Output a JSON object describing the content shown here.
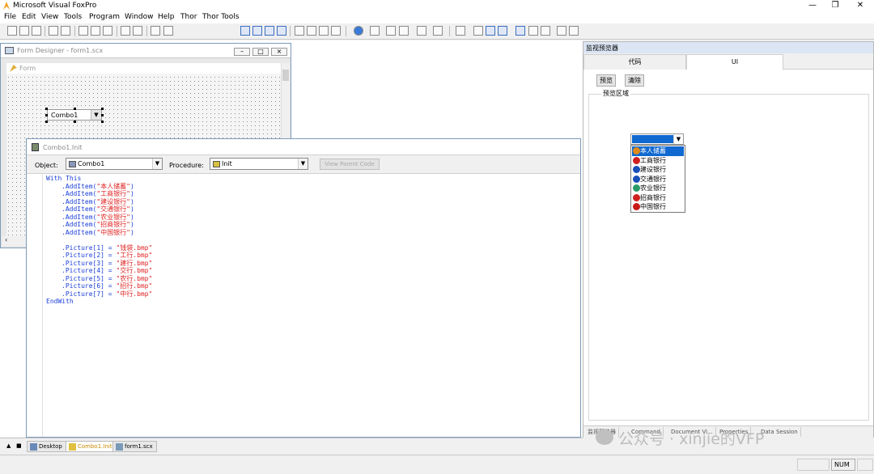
{
  "app": {
    "title": "Microsoft Visual FoxPro"
  },
  "menu": [
    "File",
    "Edit",
    "View",
    "Tools",
    "Program",
    "Window",
    "Help",
    "Thor",
    "Thor Tools"
  ],
  "form_designer": {
    "title": "Form Designer - form1.scx",
    "form_caption": "Form",
    "combo_label": "Combo1"
  },
  "code_window": {
    "title": "Combo1.Init",
    "object_label": "Object:",
    "object_value": "Combo1",
    "procedure_label": "Procedure:",
    "procedure_value": "Init",
    "view_parent_label": "View Parent Code",
    "lines": [
      {
        "text": "With This",
        "kind": "kw",
        "indent": 0
      },
      {
        "fn": ".AddItem(",
        "str": "\"本人储蓄\"",
        "end": ")",
        "indent": 1
      },
      {
        "fn": ".AddItem(",
        "str": "\"工商银行\"",
        "end": ")",
        "indent": 1
      },
      {
        "fn": ".AddItem(",
        "str": "\"建设银行\"",
        "end": ")",
        "indent": 1
      },
      {
        "fn": ".AddItem(",
        "str": "\"交通银行\"",
        "end": ")",
        "indent": 1
      },
      {
        "fn": ".AddItem(",
        "str": "\"农业银行\"",
        "end": ")",
        "indent": 1
      },
      {
        "fn": ".AddItem(",
        "str": "\"招商银行\"",
        "end": ")",
        "indent": 1
      },
      {
        "fn": ".AddItem(",
        "str": "\"中国银行\"",
        "end": ")",
        "indent": 1
      },
      {
        "text": "",
        "kind": "blank",
        "indent": 0
      },
      {
        "fn": ".Picture[1] = ",
        "str": "\"钱袋.bmp\"",
        "end": "",
        "indent": 1
      },
      {
        "fn": ".Picture[2] = ",
        "str": "\"工行.bmp\"",
        "end": "",
        "indent": 1
      },
      {
        "fn": ".Picture[3] = ",
        "str": "\"建行.bmp\"",
        "end": "",
        "indent": 1
      },
      {
        "fn": ".Picture[4] = ",
        "str": "\"交行.bmp\"",
        "end": "",
        "indent": 1
      },
      {
        "fn": ".Picture[5] = ",
        "str": "\"农行.bmp\"",
        "end": "",
        "indent": 1
      },
      {
        "fn": ".Picture[6] = ",
        "str": "\"招行.bmp\"",
        "end": "",
        "indent": 1
      },
      {
        "fn": ".Picture[7] = ",
        "str": "\"中行.bmp\"",
        "end": "",
        "indent": 1
      },
      {
        "text": "EndWith",
        "kind": "kw",
        "indent": 0
      }
    ]
  },
  "preview": {
    "title": "监视预览器",
    "tabs": [
      "代码",
      "UI"
    ],
    "active_tab": 1,
    "preview_button": "预览",
    "clear_button": "清除",
    "group_label": "预览区域",
    "list_items": [
      {
        "label": "本人储蓄",
        "icon": "money-bag-icon",
        "color": "#e08a1a"
      },
      {
        "label": "工商银行",
        "icon": "icbc-icon",
        "color": "#d02020"
      },
      {
        "label": "建设银行",
        "icon": "ccb-icon",
        "color": "#1a4fb8"
      },
      {
        "label": "交通银行",
        "icon": "bocom-icon",
        "color": "#1a4fb8"
      },
      {
        "label": "农业银行",
        "icon": "abc-icon",
        "color": "#2a9a6a"
      },
      {
        "label": "招商银行",
        "icon": "cmb-icon",
        "color": "#d02020"
      },
      {
        "label": "中国银行",
        "icon": "boc-icon",
        "color": "#c81818"
      }
    ],
    "selected_index": 0,
    "bottom_tabs": [
      "监视预览器",
      "Command",
      "Document Vi...",
      "Properties",
      "Data Session"
    ]
  },
  "window_tabs": [
    "Desktop",
    "Combo1.Init",
    "form1.scx"
  ],
  "active_window_tab": 1,
  "status": {
    "num": "NUM"
  },
  "watermark": "公众号 · xinjie的VFP",
  "colors": {
    "selection": "#0f69d0",
    "keyword": "#1a3ed8",
    "string": "#e02020"
  }
}
